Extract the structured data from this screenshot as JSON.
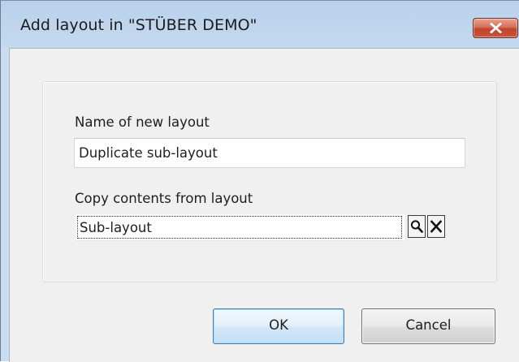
{
  "window": {
    "title": "Add layout in \"STÜBER DEMO\"",
    "close_icon": "close-icon"
  },
  "form": {
    "name_label": "Name of new layout",
    "name_value": "Duplicate sub-layout",
    "copy_label": "Copy contents from layout",
    "copy_value": "Sub-layout",
    "search_icon": "magnifier-icon",
    "clear_icon": "x-icon"
  },
  "buttons": {
    "ok_label": "OK",
    "cancel_label": "Cancel"
  },
  "colors": {
    "close_button": "#c74a32",
    "ok_border": "#3c7fb1",
    "frame": "#c4d9ef"
  }
}
